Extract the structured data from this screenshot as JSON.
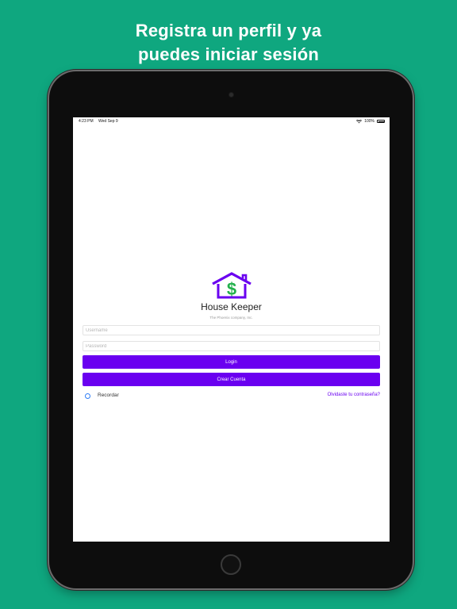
{
  "promo": {
    "headline_line1": "Registra un perfil y ya",
    "headline_line2": "puedes iniciar sesión"
  },
  "statusbar": {
    "time": "4:23 PM",
    "date": "Wed Sep 9",
    "battery": "100%",
    "icons": [
      "wifi-icon",
      "battery-icon"
    ]
  },
  "app": {
    "name": "House Keeper",
    "company": "The Phoenix company, Inc.",
    "logo": "house-dollar-logo"
  },
  "form": {
    "username_placeholder": "Username",
    "password_placeholder": "Password",
    "login_label": "Login",
    "create_label": "Crear Cuenta",
    "remember_label": "Recordar",
    "forgot_label": "Olvidaste tu contraseña?"
  },
  "colors": {
    "background": "#0fa77f",
    "accent": "#6a00f0",
    "logo_house": "#6a00f0",
    "logo_dollar": "#22b04b",
    "radio": "#2f7df6"
  }
}
